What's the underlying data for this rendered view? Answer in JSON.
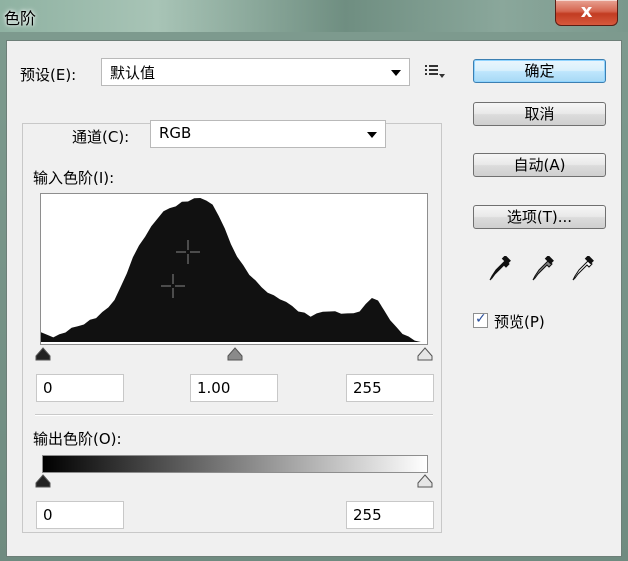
{
  "window": {
    "title": "色阶",
    "close_label": "x"
  },
  "preset": {
    "label": "预设(E):",
    "value": "默认值"
  },
  "channel": {
    "label": "通道(C):",
    "value": "RGB"
  },
  "input_levels": {
    "label": "输入色阶(I):",
    "black": "0",
    "gamma": "1.00",
    "white": "255"
  },
  "output_levels": {
    "label": "输出色阶(O):",
    "black": "0",
    "white": "255"
  },
  "buttons": {
    "ok": "确定",
    "cancel": "取消",
    "auto": "自动(A)",
    "options": "选项(T)..."
  },
  "preview": {
    "label": "预览(P)",
    "checked": true
  },
  "icons": {
    "preset_menu": "preset-options-icon",
    "eyedroppers": [
      "black-point-eyedropper-icon",
      "gray-point-eyedropper-icon",
      "white-point-eyedropper-icon"
    ]
  },
  "histogram": {
    "range": [
      0,
      255
    ],
    "profile": [
      0.06,
      0.05,
      0.04,
      0.05,
      0.07,
      0.09,
      0.11,
      0.13,
      0.15,
      0.17,
      0.2,
      0.24,
      0.3,
      0.38,
      0.48,
      0.58,
      0.67,
      0.74,
      0.8,
      0.86,
      0.9,
      0.93,
      0.95,
      0.97,
      0.98,
      0.99,
      1.0,
      0.99,
      0.95,
      0.88,
      0.78,
      0.68,
      0.6,
      0.53,
      0.47,
      0.42,
      0.38,
      0.35,
      0.32,
      0.3,
      0.27,
      0.25,
      0.22,
      0.2,
      0.18,
      0.19,
      0.21,
      0.22,
      0.21,
      0.2,
      0.19,
      0.2,
      0.22,
      0.26,
      0.31,
      0.28,
      0.22,
      0.16,
      0.1,
      0.06,
      0.03,
      0.01,
      0.0,
      0.0
    ]
  }
}
